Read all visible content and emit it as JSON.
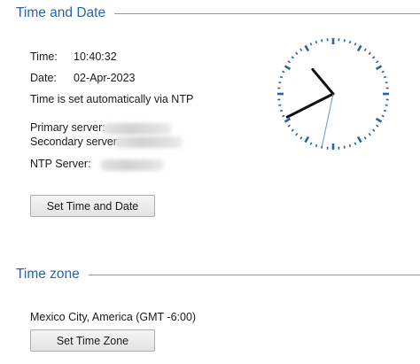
{
  "time_date_section": {
    "title": "Time and Date",
    "time_label": "Time:",
    "time_value": "10:40:32",
    "date_label": "Date:",
    "date_value": "02-Apr-2023",
    "ntp_status": "Time is set automatically via NTP",
    "primary_server_label": "Primary server:",
    "secondary_server_label": "Secondary server:",
    "ntp_server_label": "NTP Server:",
    "set_button_label": "Set Time and Date"
  },
  "clock": {
    "hour": 10,
    "minute": 40,
    "second": 32,
    "tick_color": "#2b62a8",
    "hand_color": "#111111",
    "second_hand_color": "#6b8fe0"
  },
  "time_zone_section": {
    "title": "Time zone",
    "zone_value": "Mexico City, America (GMT -6:00)",
    "set_button_label": "Set Time Zone"
  },
  "colors": {
    "section_title": "#2b62a8",
    "divider": "#9a9a9a"
  }
}
